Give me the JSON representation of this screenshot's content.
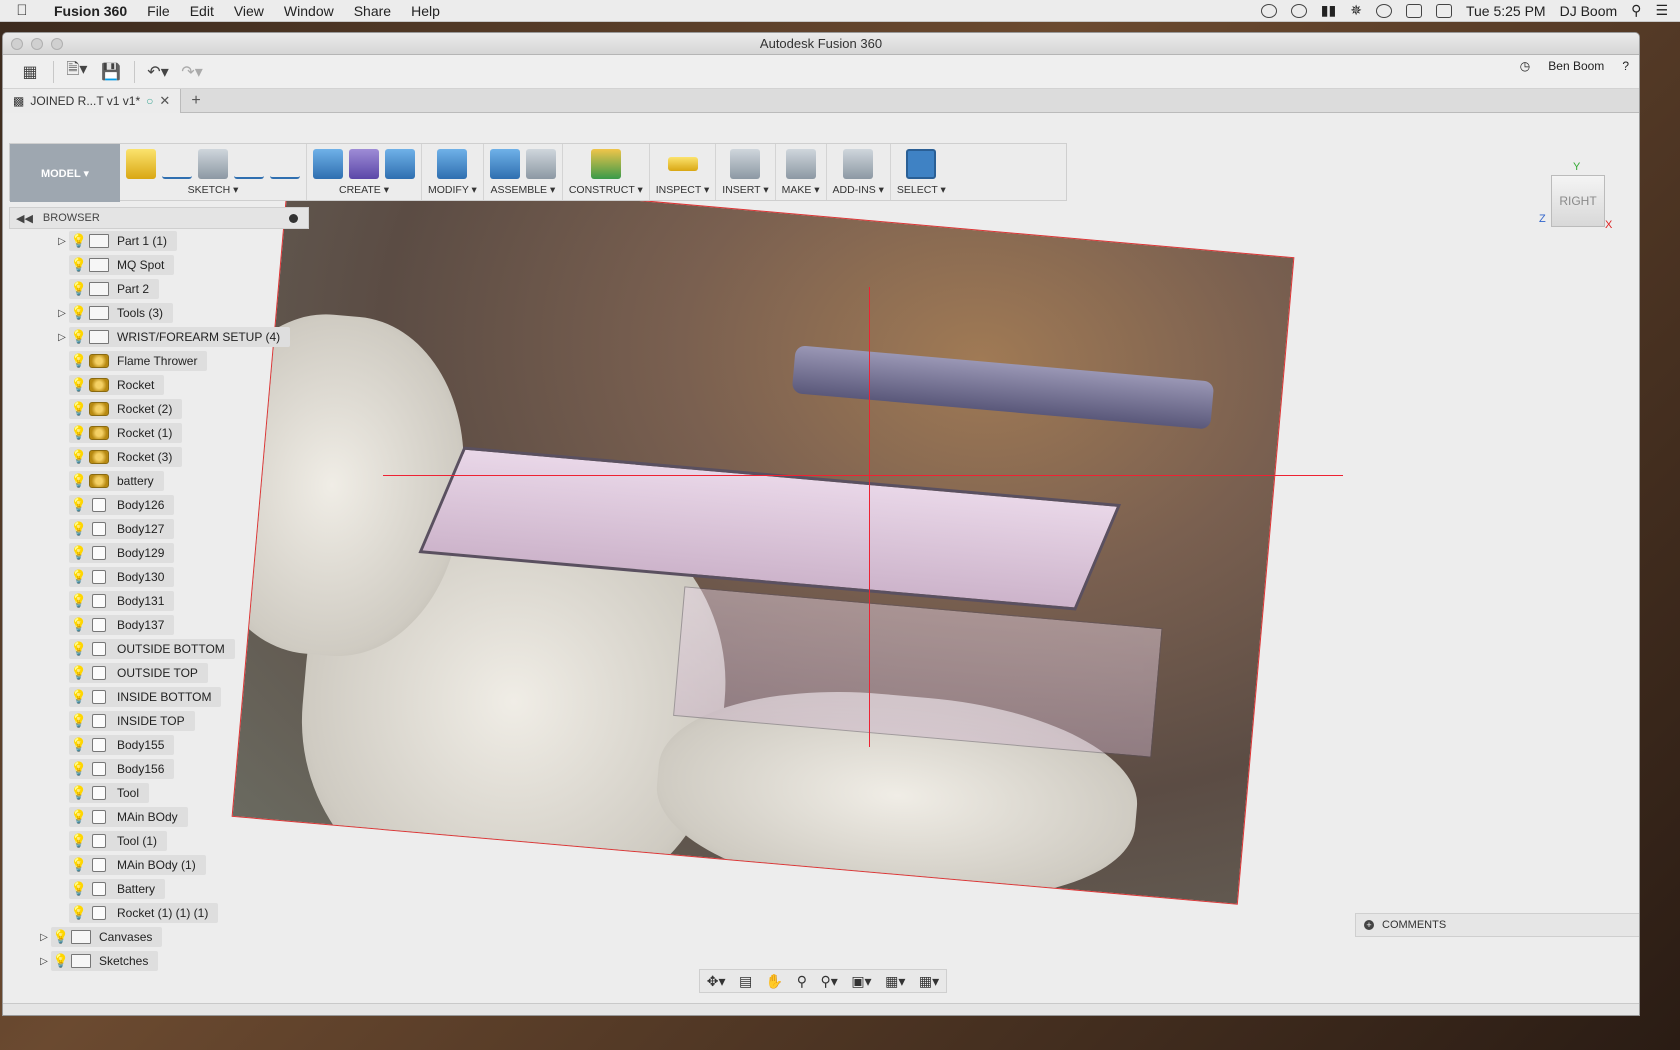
{
  "menubar": {
    "app_name": "Fusion 360",
    "items": [
      "File",
      "Edit",
      "View",
      "Window",
      "Share",
      "Help"
    ],
    "clock": "Tue 5:25 PM",
    "user": "DJ Boom"
  },
  "window": {
    "title": "Autodesk Fusion 360",
    "account": "Ben Boom",
    "help_label": "?"
  },
  "tab": {
    "label": "JOINED R...T v1 v1*",
    "close": "✕",
    "new": "+"
  },
  "toolbar": {
    "workspace": "MODEL ▾",
    "groups": [
      {
        "label": "SKETCH ▾"
      },
      {
        "label": "CREATE ▾"
      },
      {
        "label": "MODIFY ▾"
      },
      {
        "label": "ASSEMBLE ▾"
      },
      {
        "label": "CONSTRUCT ▾"
      },
      {
        "label": "INSPECT ▾"
      },
      {
        "label": "INSERT ▾"
      },
      {
        "label": "MAKE ▾"
      },
      {
        "label": "ADD-INS ▾"
      },
      {
        "label": "SELECT ▾"
      }
    ]
  },
  "browser": {
    "title": "BROWSER",
    "items": [
      {
        "name": "Part 1 (1)",
        "kind": "folder",
        "expand": true,
        "bulb": "on",
        "indent": 2
      },
      {
        "name": "MQ Spot",
        "kind": "folder",
        "expand": false,
        "bulb": "off",
        "indent": 2
      },
      {
        "name": "Part 2",
        "kind": "folder",
        "expand": false,
        "bulb": "off",
        "indent": 2
      },
      {
        "name": "Tools (3)",
        "kind": "folder",
        "expand": true,
        "bulb": "off",
        "indent": 2
      },
      {
        "name": "WRIST/FOREARM SETUP (4)",
        "kind": "folder",
        "expand": true,
        "bulb": "off",
        "indent": 2
      },
      {
        "name": "Flame Thrower",
        "kind": "comp",
        "expand": false,
        "bulb": "on",
        "indent": 2
      },
      {
        "name": "Rocket",
        "kind": "comp",
        "expand": false,
        "bulb": "on",
        "indent": 2
      },
      {
        "name": "Rocket (2)",
        "kind": "comp",
        "expand": false,
        "bulb": "on",
        "indent": 2
      },
      {
        "name": "Rocket (1)",
        "kind": "comp",
        "expand": false,
        "bulb": "on",
        "indent": 2
      },
      {
        "name": "Rocket (3)",
        "kind": "comp",
        "expand": false,
        "bulb": "on",
        "indent": 2
      },
      {
        "name": "battery",
        "kind": "comp",
        "expand": false,
        "bulb": "on",
        "indent": 2
      },
      {
        "name": "Body126",
        "kind": "body",
        "expand": false,
        "bulb": "off",
        "indent": 2
      },
      {
        "name": "Body127",
        "kind": "body",
        "expand": false,
        "bulb": "off",
        "indent": 2
      },
      {
        "name": "Body129",
        "kind": "body",
        "expand": false,
        "bulb": "off",
        "indent": 2
      },
      {
        "name": "Body130",
        "kind": "body",
        "expand": false,
        "bulb": "off",
        "indent": 2
      },
      {
        "name": "Body131",
        "kind": "body",
        "expand": false,
        "bulb": "off",
        "indent": 2
      },
      {
        "name": "Body137",
        "kind": "body",
        "expand": false,
        "bulb": "off",
        "indent": 2
      },
      {
        "name": "OUTSIDE BOTTOM",
        "kind": "body",
        "expand": false,
        "bulb": "on",
        "indent": 2
      },
      {
        "name": "OUTSIDE TOP",
        "kind": "body",
        "expand": false,
        "bulb": "on",
        "indent": 2
      },
      {
        "name": "INSIDE BOTTOM",
        "kind": "body",
        "expand": false,
        "bulb": "on",
        "indent": 2
      },
      {
        "name": "INSIDE TOP",
        "kind": "body",
        "expand": false,
        "bulb": "on",
        "indent": 2
      },
      {
        "name": "Body155",
        "kind": "body",
        "expand": false,
        "bulb": "off",
        "indent": 2
      },
      {
        "name": "Body156",
        "kind": "body",
        "expand": false,
        "bulb": "off",
        "indent": 2
      },
      {
        "name": "Tool",
        "kind": "body",
        "expand": false,
        "bulb": "off",
        "indent": 2
      },
      {
        "name": "MAin BOdy",
        "kind": "body",
        "expand": false,
        "bulb": "off",
        "indent": 2
      },
      {
        "name": "Tool (1)",
        "kind": "body",
        "expand": false,
        "bulb": "off",
        "indent": 2
      },
      {
        "name": "MAin BOdy (1)",
        "kind": "body",
        "expand": false,
        "bulb": "on",
        "indent": 2
      },
      {
        "name": "Battery",
        "kind": "body",
        "expand": false,
        "bulb": "on",
        "indent": 2
      },
      {
        "name": "Rocket (1) (1) (1)",
        "kind": "body",
        "expand": false,
        "bulb": "on",
        "indent": 2
      },
      {
        "name": "Canvases",
        "kind": "folder",
        "expand": true,
        "bulb": "on",
        "indent": 1
      },
      {
        "name": "Sketches",
        "kind": "folder",
        "expand": true,
        "bulb": "on",
        "indent": 1
      }
    ]
  },
  "viewcube": {
    "face": "RIGHT",
    "y_axis": "Y",
    "z_axis": "Z",
    "x_axis": "X"
  },
  "comments": {
    "label": "COMMENTS"
  },
  "colors": {
    "axis_red": "#e22233",
    "select_blue": "#3f82c4",
    "bulb_on": "#e1b90c",
    "bulb_off": "#8ab0cf"
  }
}
